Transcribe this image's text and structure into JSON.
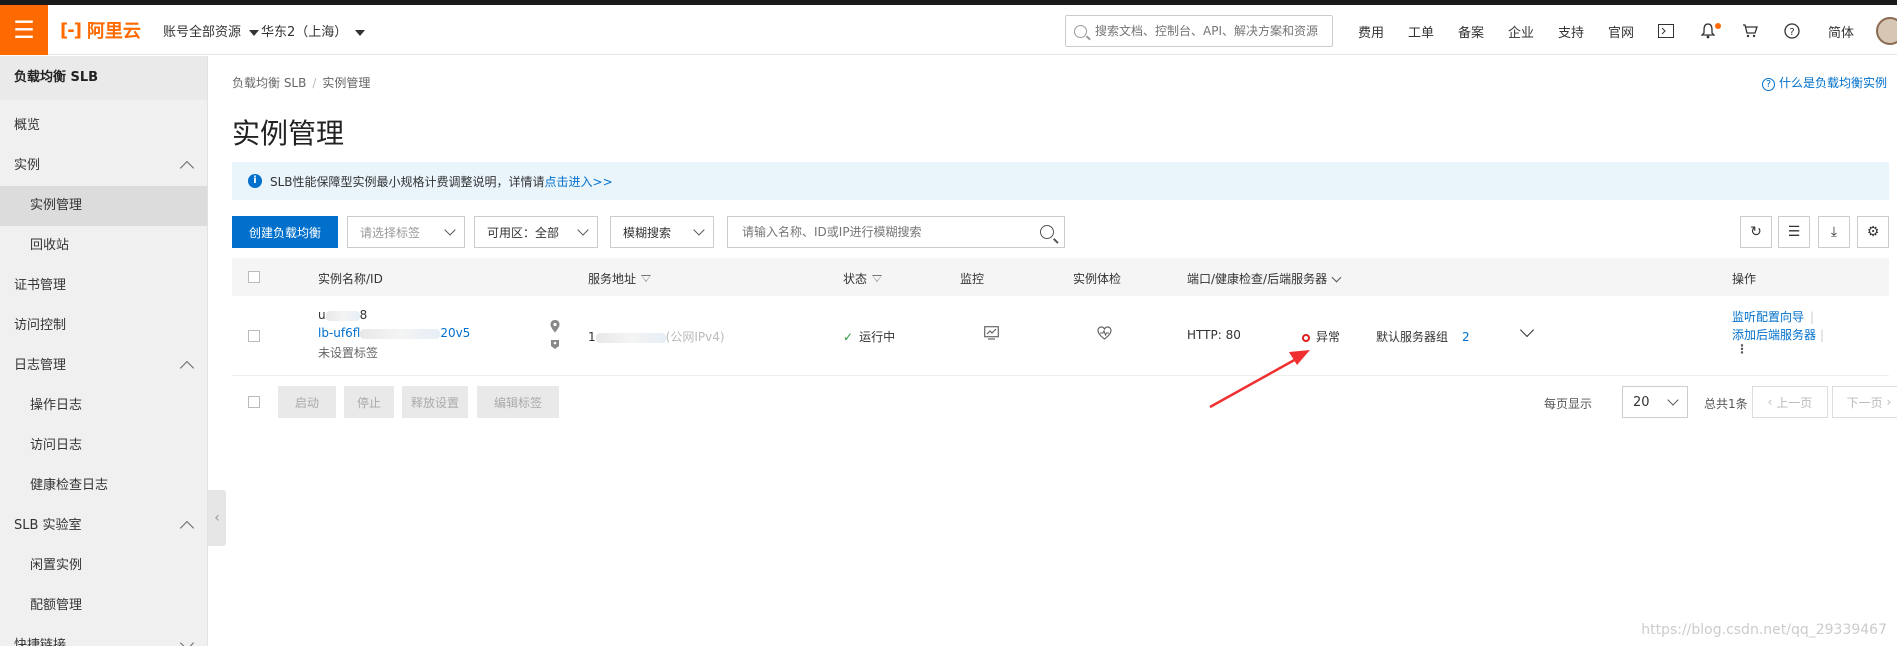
{
  "topbar": {
    "menu_icon": "hamburger-icon",
    "logo_text": "阿里云",
    "account_scope": "账号全部资源",
    "region": "华东2（上海）",
    "search_placeholder": "搜索文档、控制台、API、解决方案和资源",
    "links": [
      "费用",
      "工单",
      "备案",
      "企业",
      "支持",
      "官网"
    ],
    "lang": "简体"
  },
  "sidebar": {
    "title": "负载均衡 SLB",
    "items": [
      {
        "label": "概览"
      },
      {
        "label": "实例"
      },
      {
        "label": "实例管理"
      },
      {
        "label": "回收站"
      },
      {
        "label": "证书管理"
      },
      {
        "label": "访问控制"
      },
      {
        "label": "日志管理"
      },
      {
        "label": "操作日志"
      },
      {
        "label": "访问日志"
      },
      {
        "label": "健康检查日志"
      },
      {
        "label": "SLB 实验室"
      },
      {
        "label": "闲置实例"
      },
      {
        "label": "配额管理"
      },
      {
        "label": "快捷链接"
      }
    ]
  },
  "breadcrumb": {
    "root": "负载均衡 SLB",
    "sep": "/",
    "current": "实例管理"
  },
  "help_link": "什么是负载均衡实例",
  "page_title": "实例管理",
  "notice": {
    "text": "SLB性能保障型实例最小规格计费调整说明，详情请",
    "link": "点击进入>>"
  },
  "toolbar": {
    "create_label": "创建负载均衡",
    "tag_placeholder": "请选择标签",
    "zone_label": "可用区：全部",
    "search_mode": "模糊搜索",
    "search_placeholder": "请输入名称、ID或IP进行模糊搜索"
  },
  "table": {
    "headers": [
      "实例名称/ID",
      "服务地址",
      "状态",
      "监控",
      "实例体检",
      "端口/健康检查/后端服务器",
      "操作"
    ],
    "row": {
      "name_prefix": "u",
      "name_suffix": "8",
      "id_prefix": "lb-uf6fl",
      "id_suffix": "20v5",
      "tag": "未设置标签",
      "address_prefix": "1",
      "address_suffix": "(公网IPv4)",
      "status": "运行中",
      "port": "HTTP:  80",
      "health": "异常",
      "server_group": "默认服务器组",
      "server_count": "2",
      "actions": [
        "监听配置向导",
        "添加后端服务器"
      ]
    }
  },
  "bulk_actions": [
    "启动",
    "停止",
    "释放设置",
    "编辑标签"
  ],
  "pagination": {
    "per_page_label": "每页显示",
    "per_page": "20",
    "total": "总共1条",
    "prev": "上一页",
    "next": "下一页"
  },
  "watermark": "https://blog.csdn.net/qq_29339467",
  "colors": {
    "brand": "#ff6a00",
    "link": "#0070cc",
    "error": "#e02020",
    "arrow": "#f03030"
  }
}
